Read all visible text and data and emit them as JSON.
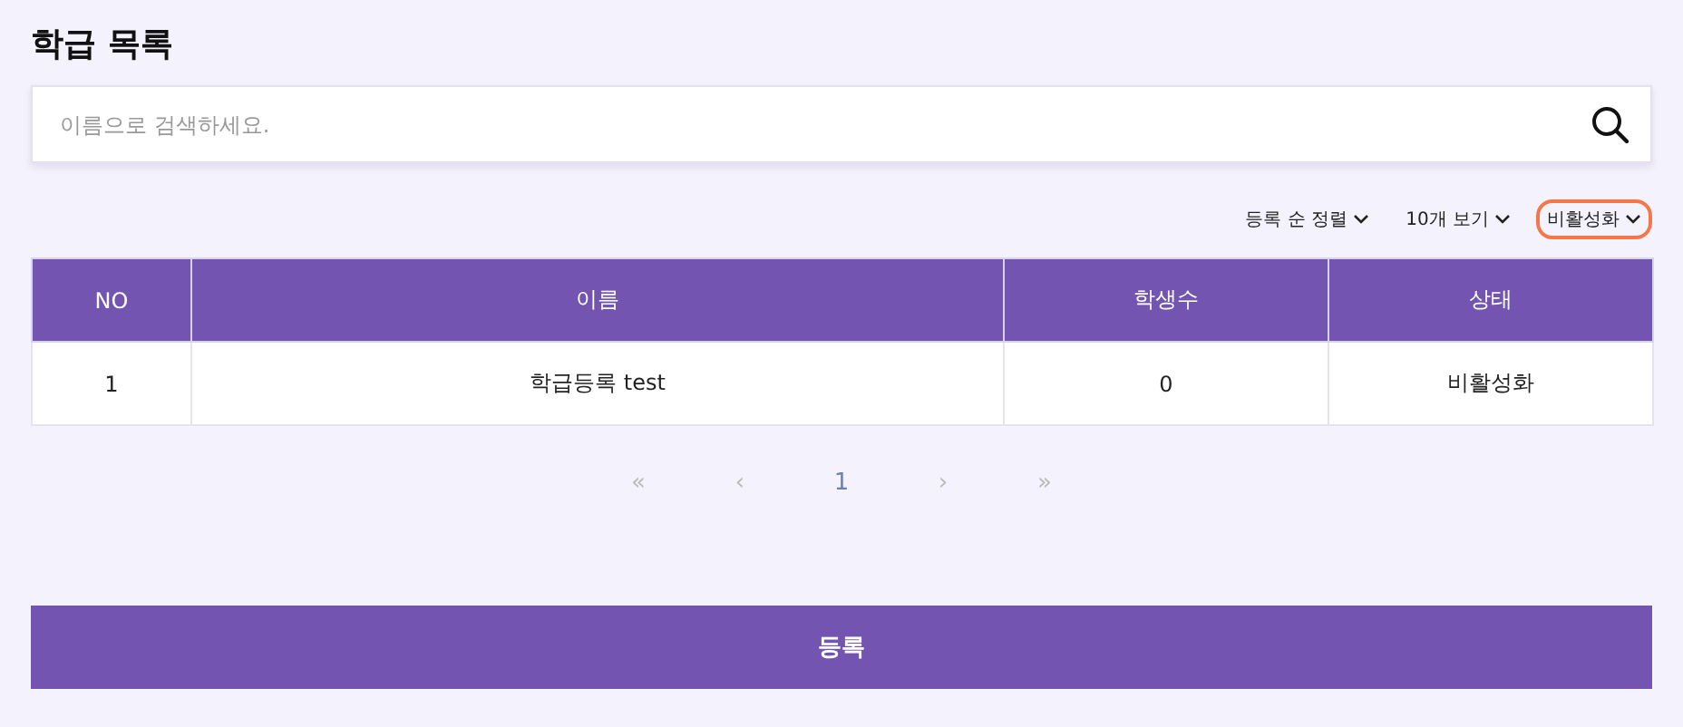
{
  "title": "학급 목록",
  "search": {
    "placeholder": "이름으로 검색하세요."
  },
  "filters": [
    {
      "label": "등록 순 정렬",
      "highlighted": false
    },
    {
      "label": "10개 보기",
      "highlighted": false
    },
    {
      "label": "비활성화",
      "highlighted": true
    }
  ],
  "table": {
    "columns": [
      "NO",
      "이름",
      "학생수",
      "상태"
    ],
    "rows": [
      [
        "1",
        "학급등록 test",
        "0",
        "비활성화"
      ]
    ]
  },
  "pagination": [
    {
      "label": "«",
      "selected": false
    },
    {
      "label": "‹",
      "selected": false
    },
    {
      "label": "1",
      "selected": true
    },
    {
      "label": "›",
      "selected": false
    },
    {
      "label": "»",
      "selected": false
    }
  ],
  "register_button": "등록"
}
